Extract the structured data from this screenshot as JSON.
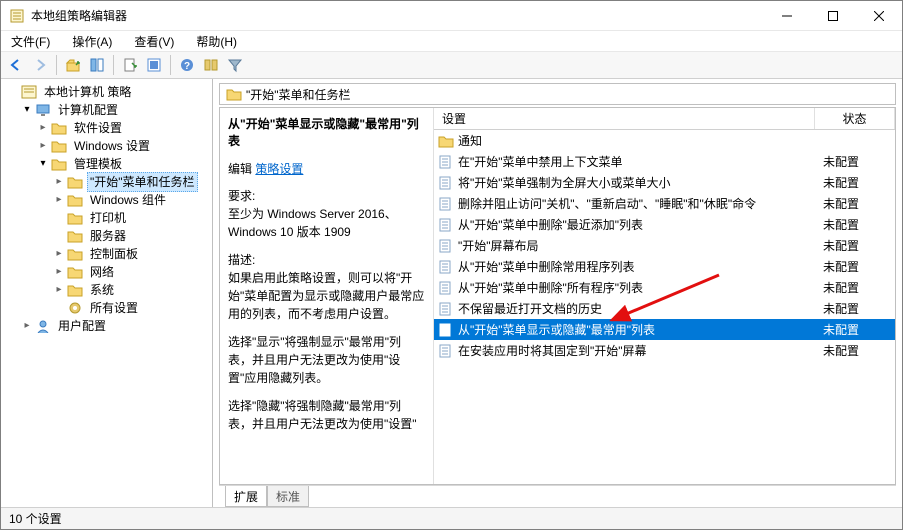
{
  "window": {
    "title": "本地组策略编辑器"
  },
  "menus": {
    "file": "文件(F)",
    "action": "操作(A)",
    "view": "查看(V)",
    "help": "帮助(H)"
  },
  "tree": {
    "root": "本地计算机 策略",
    "computer_config": "计算机配置",
    "software_settings": "软件设置",
    "windows_settings": "Windows 设置",
    "admin_templates": "管理模板",
    "start_taskbar": "\"开始\"菜单和任务栏",
    "windows_components": "Windows 组件",
    "printers": "打印机",
    "server": "服务器",
    "control_panel": "控制面板",
    "network": "网络",
    "system": "系统",
    "all_settings": "所有设置",
    "user_config": "用户配置"
  },
  "pathbar": {
    "title": "\"开始\"菜单和任务栏"
  },
  "detail": {
    "title": "从\"开始\"菜单显示或隐藏\"最常用\"列表",
    "edit_prefix": "编辑",
    "edit_link": "策略设置",
    "req_label": "要求:",
    "req_text": "至少为 Windows Server 2016、Windows 10 版本 1909",
    "desc_label": "描述:",
    "desc_p1": "如果启用此策略设置，则可以将\"开始\"菜单配置为显示或隐藏用户最常应用的列表，而不考虑用户设置。",
    "desc_p2": "选择\"显示\"将强制显示\"最常用\"列表，并且用户无法更改为使用\"设置\"应用隐藏列表。",
    "desc_p3": "选择\"隐藏\"将强制隐藏\"最常用\"列表，并且用户无法更改为使用\"设置\""
  },
  "list": {
    "col_setting": "设置",
    "col_state": "状态",
    "group_notifications": "通知",
    "items": [
      {
        "label": "在\"开始\"菜单中禁用上下文菜单",
        "state": "未配置"
      },
      {
        "label": "将\"开始\"菜单强制为全屏大小或菜单大小",
        "state": "未配置"
      },
      {
        "label": "删除并阻止访问\"关机\"、\"重新启动\"、\"睡眠\"和\"休眠\"命令",
        "state": "未配置"
      },
      {
        "label": "从\"开始\"菜单中删除\"最近添加\"列表",
        "state": "未配置"
      },
      {
        "label": "\"开始\"屏幕布局",
        "state": "未配置"
      },
      {
        "label": "从\"开始\"菜单中删除常用程序列表",
        "state": "未配置"
      },
      {
        "label": "从\"开始\"菜单中删除\"所有程序\"列表",
        "state": "未配置"
      },
      {
        "label": "不保留最近打开文档的历史",
        "state": "未配置"
      },
      {
        "label": "从\"开始\"菜单显示或隐藏\"最常用\"列表",
        "state": "未配置",
        "selected": true
      },
      {
        "label": "在安装应用时将其固定到\"开始\"屏幕",
        "state": "未配置"
      }
    ]
  },
  "tabs": {
    "extended": "扩展",
    "standard": "标准"
  },
  "status": {
    "text": "10 个设置"
  }
}
